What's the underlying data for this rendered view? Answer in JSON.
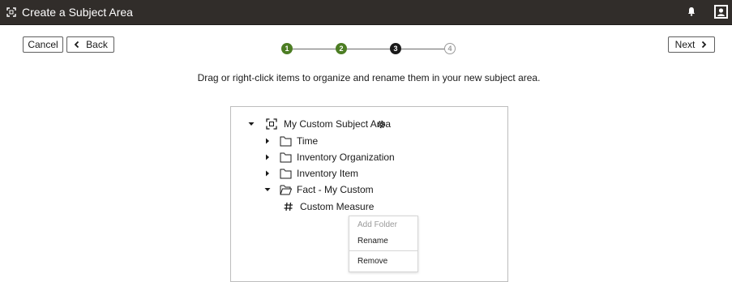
{
  "titlebar": {
    "title": "Create a Subject Area"
  },
  "toolbar": {
    "cancel_label": "Cancel",
    "back_label": "Back",
    "next_label": "Next"
  },
  "train": {
    "steps": [
      {
        "number": "1",
        "state": "complete"
      },
      {
        "number": "2",
        "state": "complete"
      },
      {
        "number": "3",
        "state": "current"
      },
      {
        "number": "4",
        "state": "upcoming"
      }
    ]
  },
  "instruction": "Drag or right-click items to organize and rename them in your new subject area.",
  "tree": {
    "root": {
      "label": "My Custom Subject Area",
      "icon": "subject-area-icon",
      "expanded": true
    },
    "items": [
      {
        "label": "Time",
        "icon": "folder-icon",
        "expanded": false
      },
      {
        "label": "Inventory Organization",
        "icon": "folder-icon",
        "expanded": false
      },
      {
        "label": "Inventory Item",
        "icon": "folder-icon",
        "expanded": false
      },
      {
        "label": "Fact - My Custom",
        "icon": "folder-open-icon",
        "expanded": true
      },
      {
        "label": "Custom Measure",
        "icon": "measure-hash-icon"
      }
    ]
  },
  "context_menu": {
    "items": [
      {
        "label": "Add Folder",
        "enabled": false
      },
      {
        "label": "Rename",
        "enabled": true
      },
      {
        "label": "Remove",
        "enabled": true
      }
    ]
  },
  "colors": {
    "titlebar_bg": "#312d2a",
    "step_complete": "#4c7d23",
    "step_current": "#1a1a1a"
  }
}
